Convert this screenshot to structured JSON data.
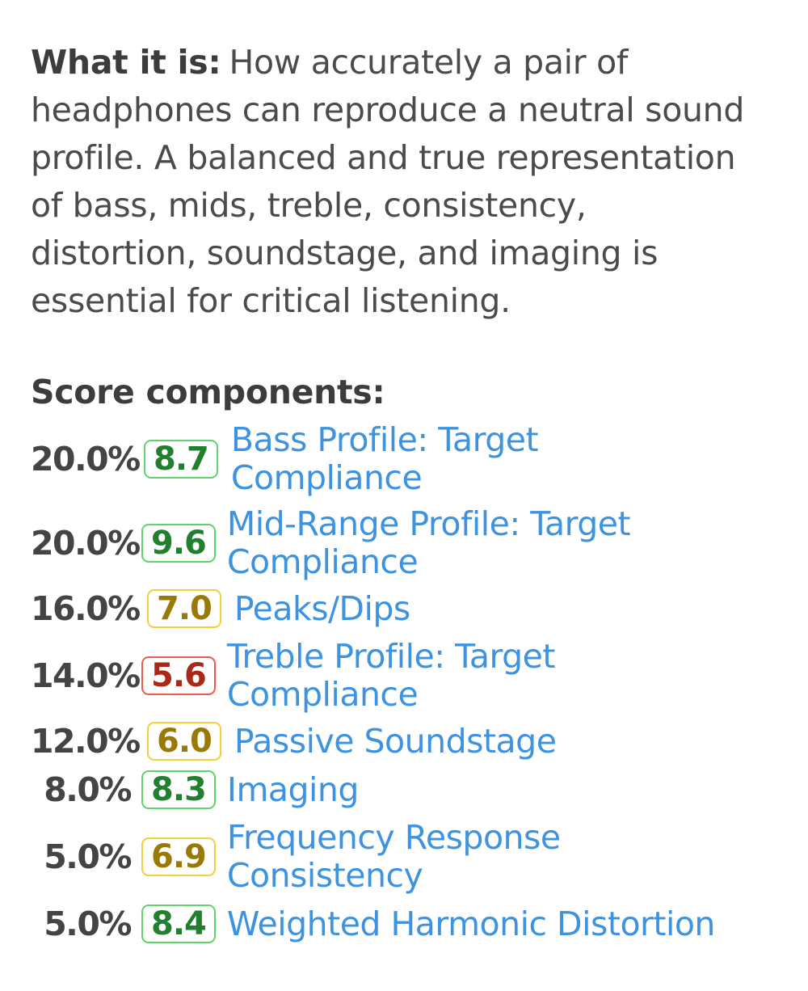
{
  "description": {
    "label": "What it is:",
    "text": "How accurately a pair of headphones can reproduce a neutral sound profile. A balanced and true representation of bass, mids, treble, consistency, distortion, soundstage, and imaging is essential for critical listening."
  },
  "score_components": {
    "title": "Score components:",
    "items": [
      {
        "weight": "20.0%",
        "score": "8.7",
        "rating": "green",
        "name": "Bass Profile: Target Compliance"
      },
      {
        "weight": "20.0%",
        "score": "9.6",
        "rating": "green",
        "name": "Mid-Range Profile: Target Compliance"
      },
      {
        "weight": "16.0%",
        "score": "7.0",
        "rating": "yellow",
        "name": "Peaks/Dips"
      },
      {
        "weight": "14.0%",
        "score": "5.6",
        "rating": "red",
        "name": "Treble Profile: Target Compliance"
      },
      {
        "weight": "12.0%",
        "score": "6.0",
        "rating": "yellow",
        "name": "Passive Soundstage"
      },
      {
        "weight": "8.0%",
        "score": "8.3",
        "rating": "green",
        "name": "Imaging"
      },
      {
        "weight": "5.0%",
        "score": "6.9",
        "rating": "yellow",
        "name": "Frequency Response Consistency"
      },
      {
        "weight": "5.0%",
        "score": "8.4",
        "rating": "green",
        "name": "Weighted Harmonic Distortion"
      }
    ]
  },
  "colors": {
    "link": "#3d93e0",
    "green_border": "#5fd36a",
    "green_text": "#227f2e",
    "yellow_border": "#f2cf3b",
    "yellow_text": "#9a7a06",
    "red_border": "#f05a48",
    "red_text": "#a8281a"
  }
}
